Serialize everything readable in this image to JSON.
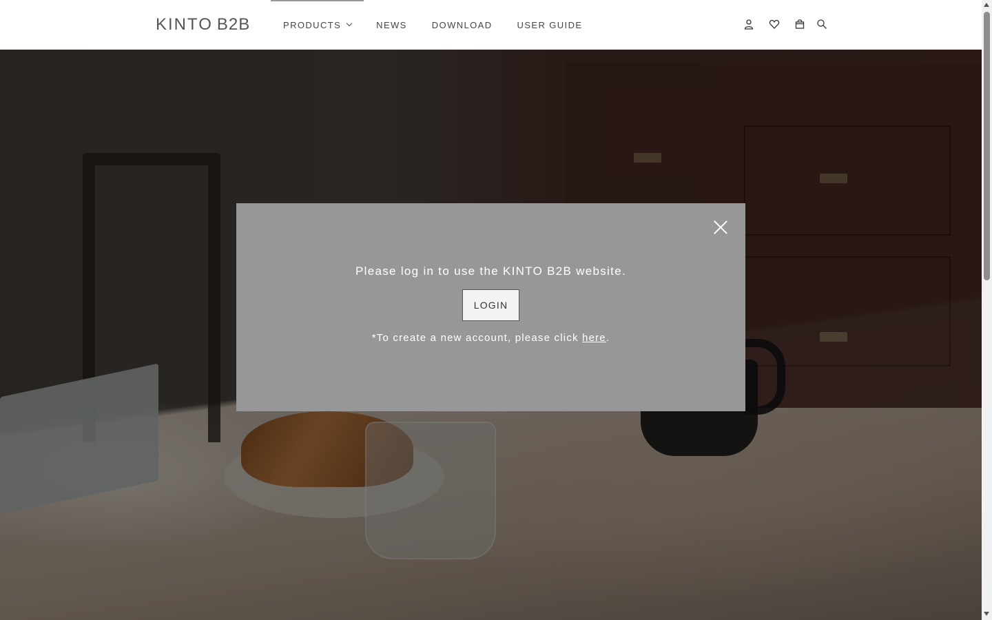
{
  "header": {
    "logo_main": "KINTO",
    "logo_sub": "B2B",
    "nav": [
      {
        "label": "PRODUCTS"
      },
      {
        "label": "NEWS"
      },
      {
        "label": "DOWNLOAD"
      },
      {
        "label": "USER GUIDE"
      }
    ],
    "icons": [
      "user-icon",
      "heart-icon",
      "bag-icon",
      "search-icon"
    ]
  },
  "modal": {
    "message": "Please log in to use the KINTO B2B website.",
    "login_label": "LOGIN",
    "note_prefix": "*To create a new account, please click ",
    "note_link": "here",
    "note_suffix": "."
  },
  "colors": {
    "modal_bg": "#979797",
    "overlay": "rgba(0,0,0,0.32)"
  }
}
